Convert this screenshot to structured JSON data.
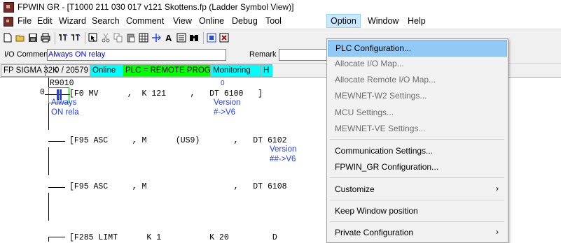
{
  "window": {
    "title": "FPWIN GR - [T1000 211 030 017 v121 Skottens.fp (Ladder Symbol View)]"
  },
  "menu": {
    "items": [
      "File",
      "Edit",
      "Wizard",
      "Search",
      "Comment",
      "View",
      "Online",
      "Debug",
      "Tool",
      "Option",
      "Window",
      "Help"
    ],
    "active": "Option"
  },
  "io": {
    "comment_label": "I/O Comment",
    "comment_value": "Always ON relay",
    "remark_label": "Remark"
  },
  "status": {
    "plc": "FP SIGMA 32K",
    "steps": "0 / 20579",
    "online": "Online",
    "mode": "PLC = REMOTE PROG",
    "monitoring": "Monitoring",
    "extra": "H"
  },
  "ladder": {
    "rung0": {
      "address": "0",
      "contact": "R9010",
      "contact_comment_1": "Always",
      "contact_comment_2": "ON rela",
      "instruction": "[F0 MV      ,  K 121     ,   DT 6100   ]",
      "mon_value": "0",
      "comment_1": "Version",
      "comment_2": "#->V6"
    },
    "rung1": {
      "instruction": "[F95 ASC     , M      (US9)       ,   DT 6102",
      "comment_1": "Version",
      "comment_2": "##->V6"
    },
    "rung2": {
      "instruction": "[F95 ASC     , M                  ,   DT 6108"
    },
    "rung3": {
      "instruction": "[F285 LIMT      K 1          K 20         D"
    }
  },
  "option_menu": {
    "items": [
      {
        "label": "PLC Configuration...",
        "enabled": true,
        "highlighted": true
      },
      {
        "label": "Allocate I/O Map...",
        "enabled": false
      },
      {
        "label": "Allocate Remote I/O Map...",
        "enabled": false
      },
      {
        "label": "MEWNET-W2 Settings...",
        "enabled": false
      },
      {
        "label": "MCU Settings...",
        "enabled": false
      },
      {
        "label": "MEWNET-VE Settings...",
        "enabled": false
      },
      {
        "label": "Communication Settings...",
        "enabled": true
      },
      {
        "label": "FPWIN_GR Configuration...",
        "enabled": true
      },
      {
        "label": "Customize",
        "enabled": true,
        "submenu": true
      },
      {
        "label": "Keep Window position",
        "enabled": true
      },
      {
        "label": "Private Configuration",
        "enabled": true,
        "submenu": true
      }
    ]
  },
  "colors": {
    "status_online_bg": "#00ffff",
    "status_mode_bg": "#00ff00",
    "status_monitor_bg": "#00ffff",
    "comment_blue": "#1e40ff",
    "menu_highlight": "#91c9f7"
  }
}
